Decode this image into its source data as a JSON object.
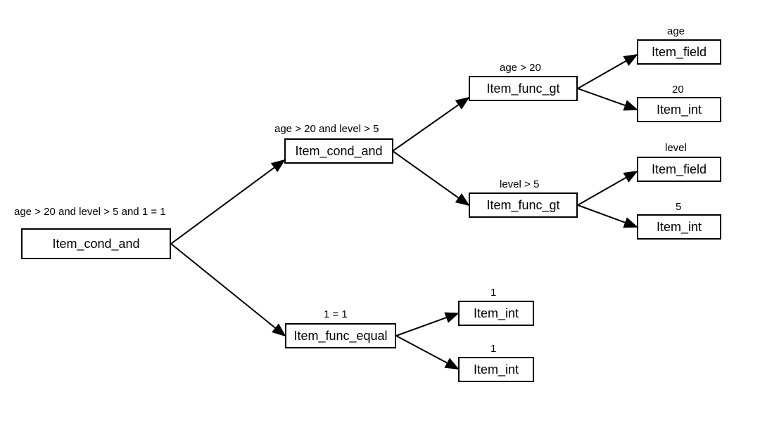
{
  "root": {
    "caption": "age > 20 and level > 5 and 1 = 1",
    "label": "Item_cond_and"
  },
  "level2_and": {
    "caption": "age > 20 and level > 5",
    "label": "Item_cond_and"
  },
  "level2_equal": {
    "caption": "1 = 1",
    "label": "Item_func_equal"
  },
  "gt_age": {
    "caption": "age > 20",
    "label": "Item_func_gt"
  },
  "gt_level": {
    "caption": "level > 5",
    "label": "Item_func_gt"
  },
  "field_age": {
    "caption": "age",
    "label": "Item_field"
  },
  "int_20": {
    "caption": "20",
    "label": "Item_int"
  },
  "field_level": {
    "caption": "level",
    "label": "Item_field"
  },
  "int_5": {
    "caption": "5",
    "label": "Item_int"
  },
  "equal_left": {
    "caption": "1",
    "label": "Item_int"
  },
  "equal_right": {
    "caption": "1",
    "label": "Item_int"
  }
}
